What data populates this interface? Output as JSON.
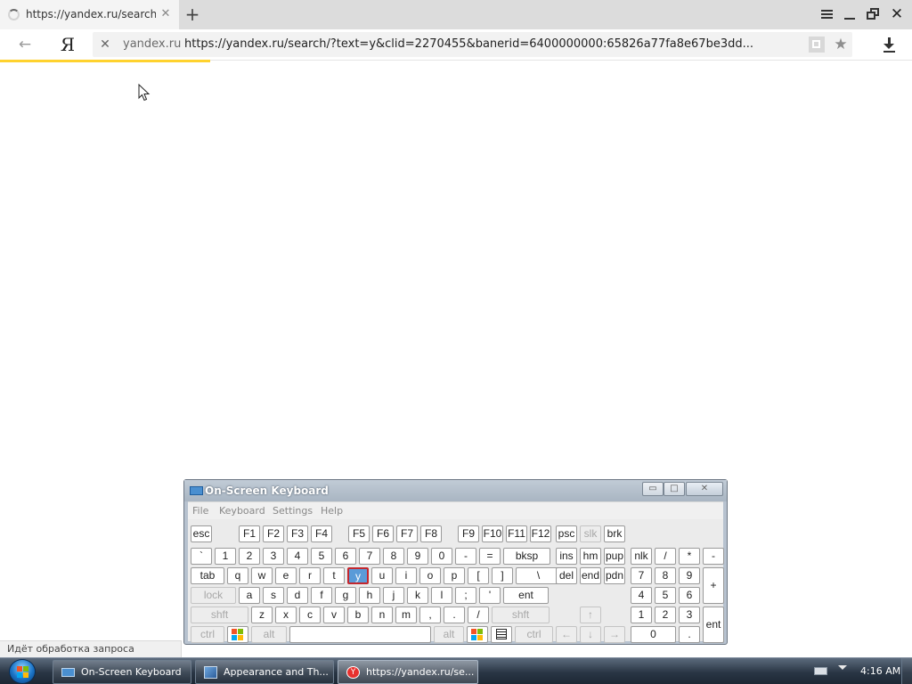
{
  "browser": {
    "tab": {
      "title": "https://yandex.ru/search/",
      "close_glyph": "✕"
    },
    "new_tab_glyph": "+",
    "window_controls": {
      "close_glyph": "✕"
    },
    "nav": {
      "back_glyph": "←",
      "logo": "Я",
      "stop_glyph": "✕",
      "domain": "yandex.ru",
      "url": "https://yandex.ru/search/?text=y&clid=2270455&banerid=6400000000:65826a77fa8e67be3dd...",
      "star_glyph": "★"
    },
    "load_progress": 0.23,
    "status_text": "Идёт обработка запроса",
    "accent_color": "#ffd22e"
  },
  "osk": {
    "title": "On-Screen Keyboard",
    "controls": {
      "min": "▭",
      "max": "□",
      "close": "✕"
    },
    "menu": [
      "File",
      "Keyboard",
      "Settings",
      "Help"
    ],
    "rows": {
      "function": [
        "esc",
        "F1",
        "F2",
        "F3",
        "F4",
        "F5",
        "F6",
        "F7",
        "F8",
        "F9",
        "F10",
        "F11",
        "F12",
        "psc",
        "slk",
        "brk"
      ],
      "numbers": [
        "`",
        "1",
        "2",
        "3",
        "4",
        "5",
        "6",
        "7",
        "8",
        "9",
        "0",
        "-",
        "=",
        "bksp",
        "ins",
        "hm",
        "pup",
        "nlk",
        "/",
        "*",
        "-"
      ],
      "qwerty": [
        "tab",
        "q",
        "w",
        "e",
        "r",
        "t",
        "y",
        "u",
        "i",
        "o",
        "p",
        "[",
        "]",
        "\\",
        "del",
        "end",
        "pdn",
        "7",
        "8",
        "9",
        "+"
      ],
      "home": [
        "lock",
        "a",
        "s",
        "d",
        "f",
        "g",
        "h",
        "j",
        "k",
        "l",
        ";",
        "'",
        "ent",
        "4",
        "5",
        "6"
      ],
      "shift": [
        "shft",
        "z",
        "x",
        "c",
        "v",
        "b",
        "n",
        "m",
        ",",
        ".",
        "/",
        "shft",
        "↑",
        "1",
        "2",
        "3",
        "ent"
      ],
      "bottom": [
        "ctrl",
        "",
        "alt",
        "",
        "alt",
        "",
        "",
        "ctrl",
        "←",
        "↓",
        "→",
        "0",
        "."
      ]
    },
    "active_key": "y",
    "active_color": "#5a9bd8"
  },
  "taskbar": {
    "items": [
      {
        "label": "On-Screen Keyboard",
        "icon": "keyboard-icon"
      },
      {
        "label": "Appearance and Th...",
        "icon": "appearance-icon"
      },
      {
        "label": "https://yandex.ru/se...",
        "icon": "yandex-browser-icon"
      }
    ],
    "clock": "4:16 AM"
  }
}
